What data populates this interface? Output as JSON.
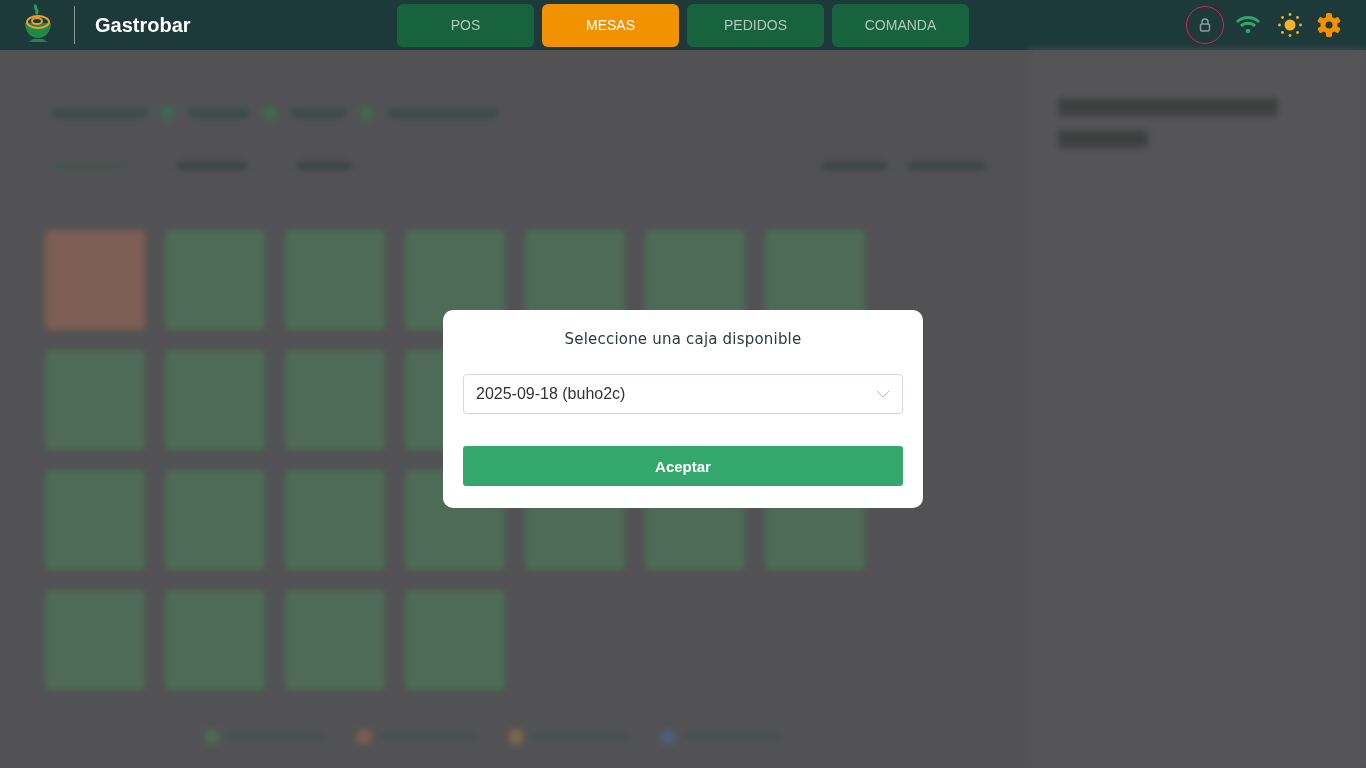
{
  "header": {
    "title": "Gastrobar",
    "tabs": [
      {
        "label": "POS",
        "selected": false
      },
      {
        "label": "MESAS",
        "selected": true
      },
      {
        "label": "PEDIDOS",
        "selected": false
      },
      {
        "label": "COMANDA",
        "selected": false
      }
    ]
  },
  "tables": [
    [
      {
        "color": "#7d5d54"
      },
      {
        "color": "#4d6b56"
      },
      {
        "color": "#4d6b56"
      },
      {
        "color": "#4d6b56"
      },
      {
        "color": "#4d6b56"
      },
      {
        "color": "#4d6b56"
      },
      {
        "color": "#4d6b56"
      }
    ],
    [
      {
        "color": "#4d6b56"
      },
      {
        "color": "#4d6b56"
      },
      {
        "color": "#4d6b56"
      },
      {
        "color": "#4d6b56"
      }
    ],
    [
      {
        "color": "#4d6b56"
      },
      {
        "color": "#4d6b56"
      },
      {
        "color": "#4d6b56"
      },
      {
        "color": "#4d6b56"
      },
      {
        "color": "#4d6b56"
      },
      {
        "color": "#4d6b56"
      },
      {
        "color": "#4d6b56"
      }
    ],
    [
      {
        "color": "#4d6b56"
      },
      {
        "color": "#4d6b56"
      },
      {
        "color": "#4d6b56"
      },
      {
        "color": "#4d6b56"
      }
    ]
  ],
  "filters": [
    {
      "color": "#3f6a52"
    },
    {
      "color": "#3f6a52"
    },
    {
      "color": "#3f6a52"
    }
  ],
  "legend": [
    {
      "color": "#4d6b56"
    },
    {
      "color": "#7d5d54"
    },
    {
      "color": "#7a6a4e"
    },
    {
      "color": "#4e5e7a"
    }
  ],
  "modal": {
    "title": "Seleccione una caja disponible",
    "select_value": "2025-09-18 (buho2c)",
    "button": "Aceptar"
  }
}
